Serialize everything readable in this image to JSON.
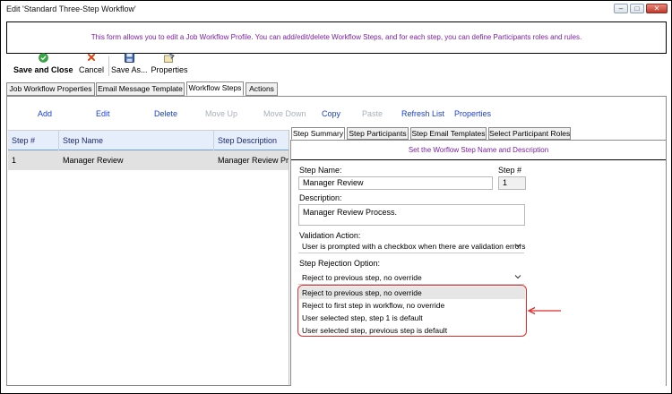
{
  "window": {
    "title": "Edit 'Standard Three-Step Workflow'",
    "controls": [
      "–",
      "□",
      "✕"
    ]
  },
  "info": {
    "text": "This form allows you to edit a Job Workflow Profile. You can add/edit/delete Workflow Steps, and for each step, you can define Participants roles and rules."
  },
  "toolbar": {
    "save_close": {
      "label": "Save and Close",
      "icon": "check-circle-icon",
      "color": "#2e9b3a"
    },
    "cancel": {
      "label": "Cancel",
      "icon": "x-icon",
      "color": "#d64a1a"
    },
    "save_as": {
      "label": "Save As...",
      "icon": "floppy-icon"
    },
    "properties": {
      "label": "Properties",
      "icon": "properties-icon"
    }
  },
  "main_tabs": [
    {
      "label": "Job Workflow Properties",
      "active": false
    },
    {
      "label": "Email Message Template",
      "active": false
    },
    {
      "label": "Workflow Steps",
      "active": true
    },
    {
      "label": "Actions",
      "active": false
    }
  ],
  "actions": [
    {
      "label": "Add",
      "enabled": true
    },
    {
      "label": "Edit",
      "enabled": true
    },
    {
      "label": "Delete",
      "enabled": true
    },
    {
      "label": "Move Up",
      "enabled": false
    },
    {
      "label": "Move Down",
      "enabled": false
    },
    {
      "label": "Copy",
      "enabled": true
    },
    {
      "label": "Paste",
      "enabled": false
    },
    {
      "label": "Refresh List",
      "enabled": true
    },
    {
      "label": "Properties",
      "enabled": true
    }
  ],
  "grid": {
    "columns": [
      "Step #",
      "Step Name",
      "Step Description"
    ],
    "rows": [
      [
        "1",
        "Manager Review",
        "Manager Review Proc"
      ]
    ]
  },
  "sub_tabs": [
    {
      "label": "Step Summary",
      "active": true
    },
    {
      "label": "Step Participants",
      "active": false
    },
    {
      "label": "Step Email Templates",
      "active": false
    },
    {
      "label": "Select Participant Roles",
      "active": false
    }
  ],
  "panel": {
    "heading": "Set the Worflow Step Name and Description",
    "step_name_label": "Step Name:",
    "step_name_value": "Manager Review",
    "step_number_label": "Step #",
    "step_number_value": "1",
    "description_label": "Description:",
    "description_value": "Manager Review Process.",
    "validation_label": "Validation Action:",
    "validation_value": "User is prompted with a checkbox when there are validation errors",
    "rejection_label": "Step Rejection Option:",
    "rejection_value": "Reject to previous step, no override",
    "rejection_options": [
      "Reject to previous step, no override",
      "Reject to first step in workflow, no override",
      "User selected step, step 1 is default",
      "User selected step, previous step is default"
    ]
  },
  "annotation": {
    "color": "#e02b2b"
  }
}
